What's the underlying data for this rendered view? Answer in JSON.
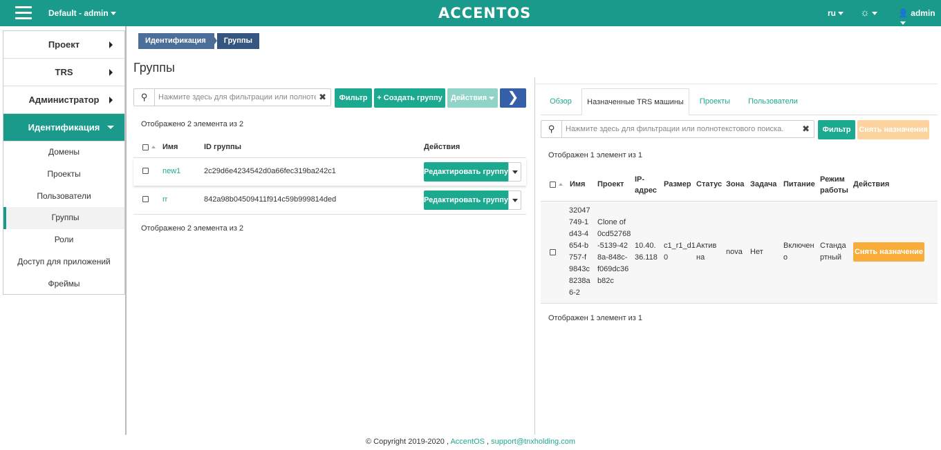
{
  "header": {
    "context": "Default - admin",
    "logo": "ACCENTOS",
    "lang": "ru",
    "user": "admin"
  },
  "sidebar": {
    "sections": [
      {
        "label": "Проект"
      },
      {
        "label": "TRS"
      },
      {
        "label": "Администратор"
      },
      {
        "label": "Идентификация"
      }
    ],
    "subitems": [
      {
        "label": "Домены"
      },
      {
        "label": "Проекты"
      },
      {
        "label": "Пользователи"
      },
      {
        "label": "Группы"
      },
      {
        "label": "Роли"
      },
      {
        "label": "Доступ для приложений"
      },
      {
        "label": "Фреймы"
      }
    ]
  },
  "breadcrumb": {
    "items": [
      "Идентификация",
      "Группы"
    ]
  },
  "page_title": "Группы",
  "left": {
    "search_placeholder": "Нажмите здесь для фильтрации или полнотекс...",
    "filter_label": "Фильтр",
    "create_label": "+ Создать группу",
    "actions_label": "Действия",
    "count_text": "Отображено 2 элемента из 2",
    "columns": [
      "Имя",
      "ID группы",
      "Действия"
    ],
    "rows": [
      {
        "name": "new1",
        "id": "2c29d6e4234542d0a66fec319ba242c1",
        "action": "Редактировать группу"
      },
      {
        "name": "rr",
        "id": "842a98b04509411f914c59b999814ded",
        "action": "Редактировать группу"
      }
    ]
  },
  "right": {
    "tabs": [
      "Обзор",
      "Назначенные TRS машины",
      "Проекты",
      "Пользователи"
    ],
    "search_placeholder": "Нажмите здесь для фильтрации или полнотекстового поиска.",
    "filter_label": "Фильтр",
    "unassign_label": "Снять назначения",
    "count_text": "Отображен 1 элемент из 1",
    "columns": [
      "Имя",
      "Проект",
      "IP-адрес",
      "Размер",
      "Статус",
      "Зона",
      "Задача",
      "Питание",
      "Режим работы",
      "Действия"
    ],
    "row": {
      "name_lines": [
        "32047",
        "749-1",
        "d43-4",
        "654-b",
        "757-f",
        "9843c",
        "8238a",
        "6-2"
      ],
      "project_lines": [
        "Clone of",
        "0cd52768",
        "-5139-42",
        "8a-848c-",
        "f069dc36",
        "b82c"
      ],
      "ip_lines": [
        "10.40.",
        "36.118"
      ],
      "size_lines": [
        "c1_r1_d1",
        "0"
      ],
      "status_lines": [
        "Актив",
        "на"
      ],
      "zone": "nova",
      "task": "Нет",
      "power_lines": [
        "Включен",
        "о"
      ],
      "mode_lines": [
        "Станда",
        "ртный"
      ],
      "action": "Снять назначение"
    }
  },
  "footer": {
    "copyright": "© Copyright 2019-2020 ,",
    "link1": "AccentOS",
    "sep": ",",
    "link2": "support@tnxholding.com"
  }
}
